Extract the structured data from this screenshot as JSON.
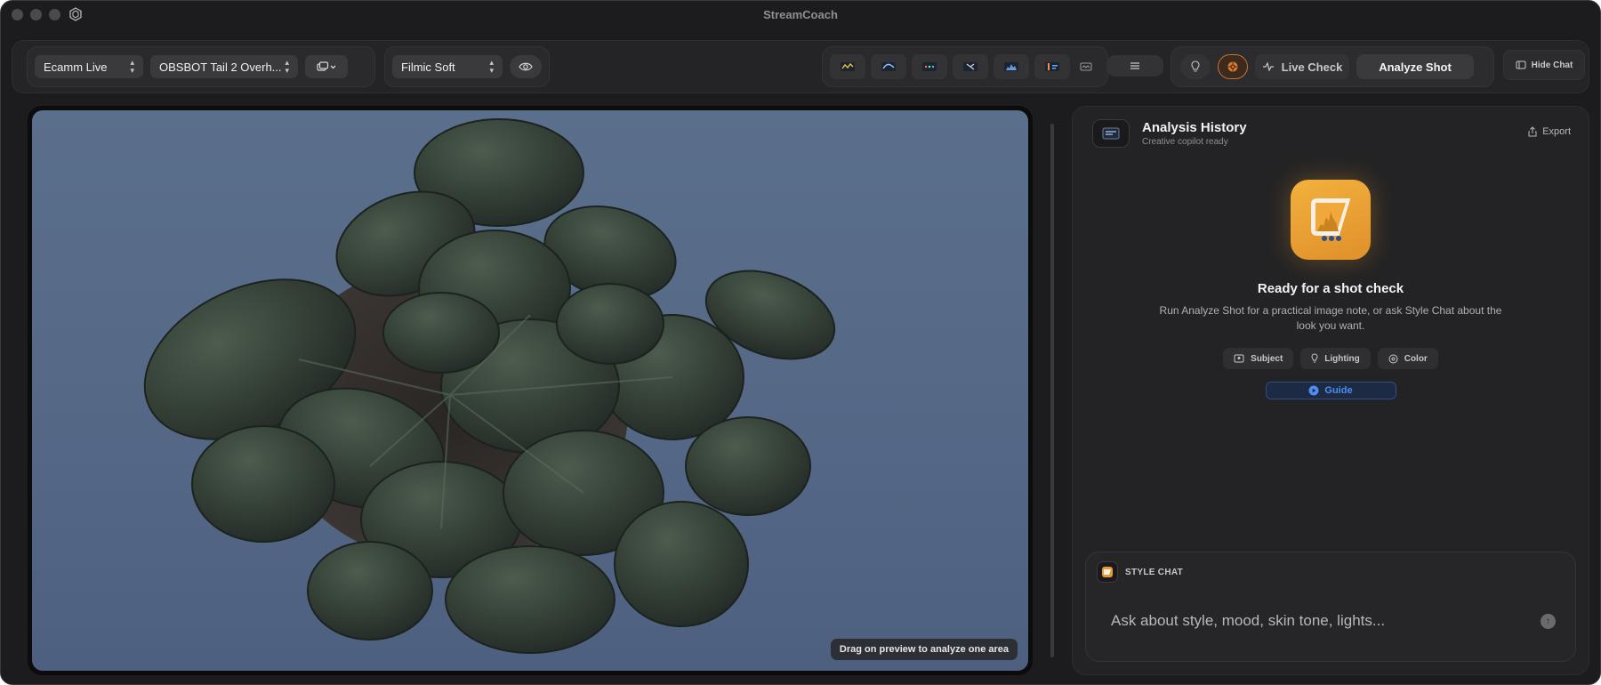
{
  "window": {
    "title": "StreamCoach"
  },
  "toolbar": {
    "platform_select": "Ecamm Live",
    "camera_select": "OBSBOT Tail 2 Overh...",
    "look_select": "Filmic Soft",
    "live_check_label": "Live Check",
    "analyze_label": "Analyze Shot",
    "hide_chat_label": "Hide Chat"
  },
  "preview": {
    "hint": "Drag on preview to analyze one area"
  },
  "panel": {
    "title": "Analysis History",
    "subtitle": "Creative copilot ready",
    "export_label": "Export",
    "empty_title": "Ready for a shot check",
    "empty_desc": "Run Analyze Shot for a practical image note, or ask Style Chat about the look you want.",
    "chips": [
      "Subject",
      "Lighting",
      "Color"
    ],
    "guide_label": "Guide"
  },
  "chat": {
    "label": "STYLE CHAT",
    "placeholder": "Ask about style, mood, skin tone, lights..."
  },
  "colors": {
    "accent_orange": "#e89a2e",
    "accent_blue": "#4d8df5",
    "backdrop_blue": "#566a88"
  }
}
